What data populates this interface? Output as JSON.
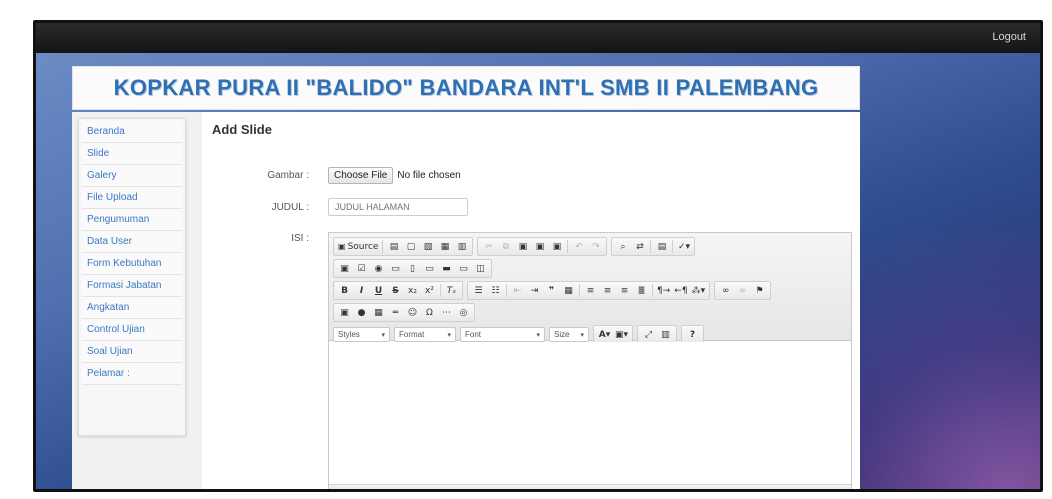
{
  "topbar": {
    "logout_label": "Logout"
  },
  "header": {
    "title": "KOPKAR PURA II \"BALIDO\" BANDARA INT'L SMB II PALEMBANG"
  },
  "sidebar": {
    "items": [
      {
        "label": "Beranda"
      },
      {
        "label": "Slide"
      },
      {
        "label": "Galery"
      },
      {
        "label": "File Upload"
      },
      {
        "label": "Pengumuman"
      },
      {
        "label": "Data User"
      },
      {
        "label": "Form Kebutuhan"
      },
      {
        "label": "Formasi Jabatan"
      },
      {
        "label": "Angkatan"
      },
      {
        "label": "Control Ujian"
      },
      {
        "label": "Soal Ujian"
      },
      {
        "label": "Pelamar :"
      }
    ]
  },
  "main": {
    "heading": "Add Slide",
    "gambar": {
      "label": "Gambar :",
      "button": "Choose File",
      "status": "No file chosen"
    },
    "judul": {
      "label": "JUDUL :",
      "placeholder": "JUDUL HALAMAN",
      "value": ""
    },
    "isi": {
      "label": "ISI :"
    }
  },
  "editor": {
    "source_label": "Source",
    "combos": {
      "styles": "Styles",
      "format": "Format",
      "font": "Font",
      "size": "Size"
    },
    "help_label": "?"
  },
  "colors": {
    "title_blue": "#2f6fb3",
    "link_blue": "#3a78c3",
    "topbar": "#1a1a1a"
  }
}
